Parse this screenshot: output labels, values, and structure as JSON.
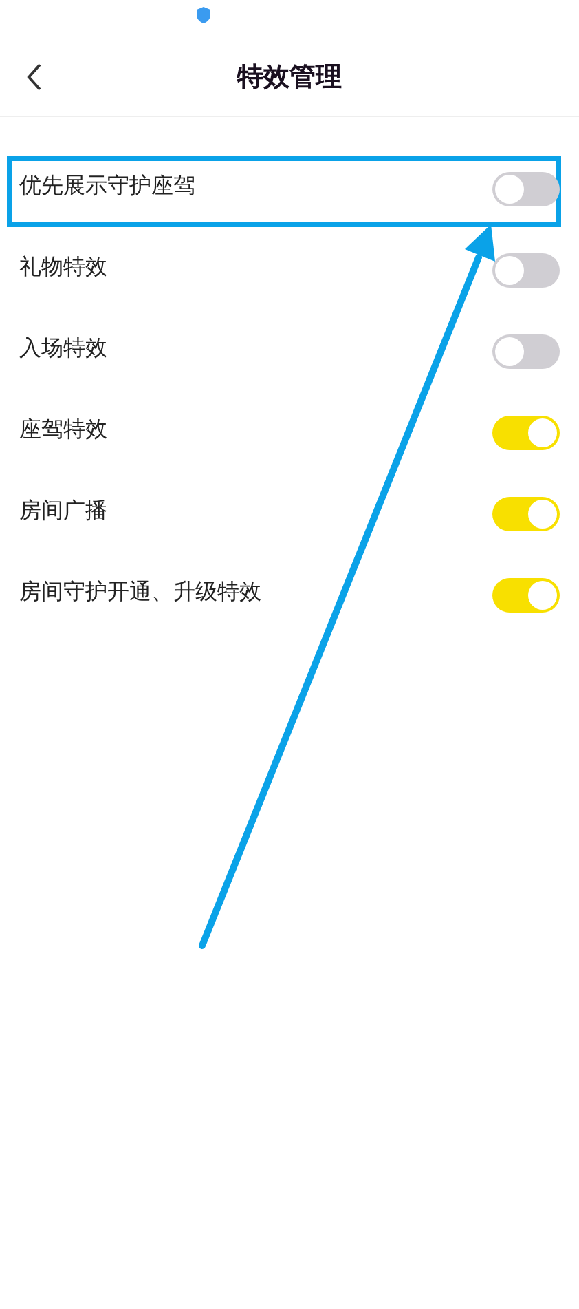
{
  "header": {
    "title": "特效管理"
  },
  "settings": [
    {
      "label": "优先展示守护座驾",
      "on": false,
      "highlighted": true
    },
    {
      "label": "礼物特效",
      "on": false,
      "highlighted": false
    },
    {
      "label": "入场特效",
      "on": false,
      "highlighted": false
    },
    {
      "label": "座驾特效",
      "on": true,
      "highlighted": false
    },
    {
      "label": "房间广播",
      "on": true,
      "highlighted": false
    },
    {
      "label": "房间守护开通、升级特效",
      "on": true,
      "highlighted": false
    }
  ]
}
